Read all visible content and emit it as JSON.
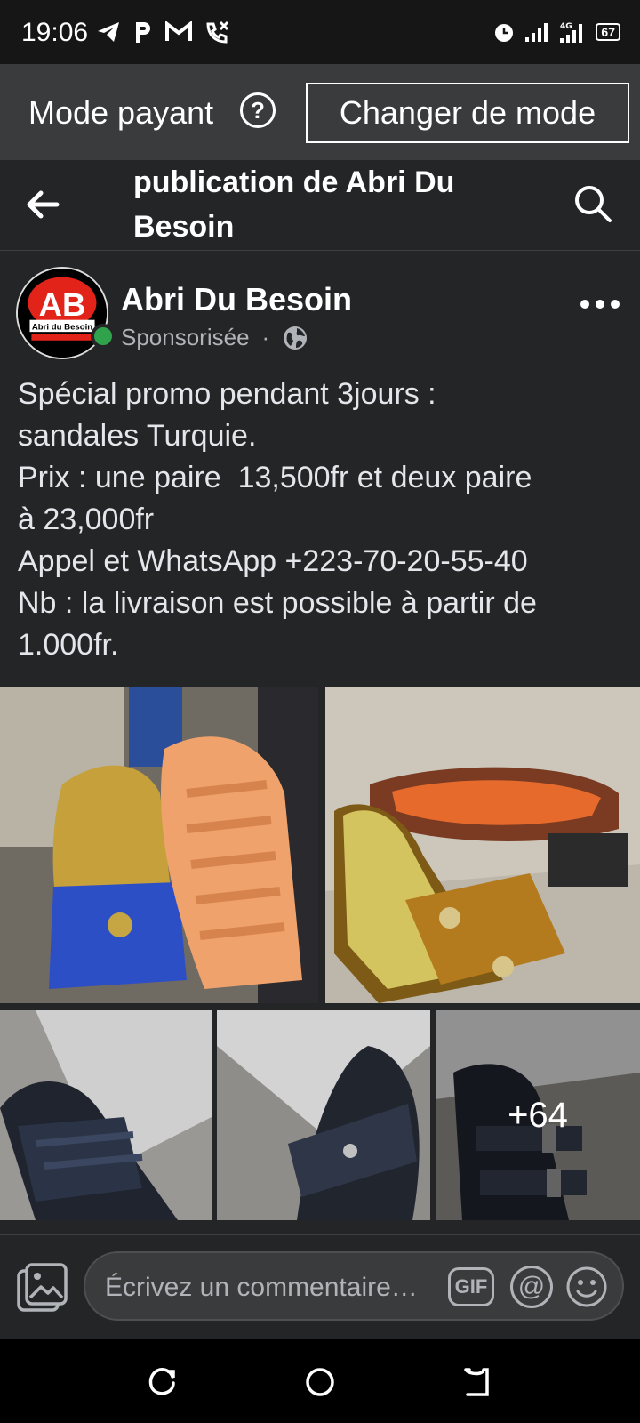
{
  "status_bar": {
    "time": "19:06",
    "left_icons": [
      "telegram-icon",
      "parking-icon",
      "gmail-icon",
      "missed-call-icon"
    ],
    "right_icons": [
      "alarm-icon",
      "signal-icon",
      "signal-4g-icon"
    ],
    "battery": "67"
  },
  "mode_bar": {
    "label": "Mode payant",
    "help": "?",
    "button": "Changer de mode"
  },
  "top_nav": {
    "title": "publication de Abri Du Besoin"
  },
  "post": {
    "author": "Abri Du Besoin",
    "avatar_text": "AB",
    "avatar_subtext": "Abri du Besoin",
    "meta": "Sponsorisée",
    "separator": "·",
    "text_lines": [
      "Spécial promo pendant 3jours :",
      "sandales Turquie.",
      "Prix : une paire  13,500fr et deux paire",
      "à 23,000fr",
      "Appel et WhatsApp +223-70-20-55-40",
      "Nb : la livraison est possible à partir de",
      "1.000fr."
    ],
    "more_photos": "+64"
  },
  "comment_bar": {
    "placeholder": "Écrivez un commentaire…",
    "gif": "GIF",
    "mention": "@"
  },
  "colors": {
    "background": "#242526",
    "mode_bar": "#3a3b3c",
    "status_bar": "#161616",
    "online": "#31a24c",
    "avatar_red": "#e2231a"
  }
}
